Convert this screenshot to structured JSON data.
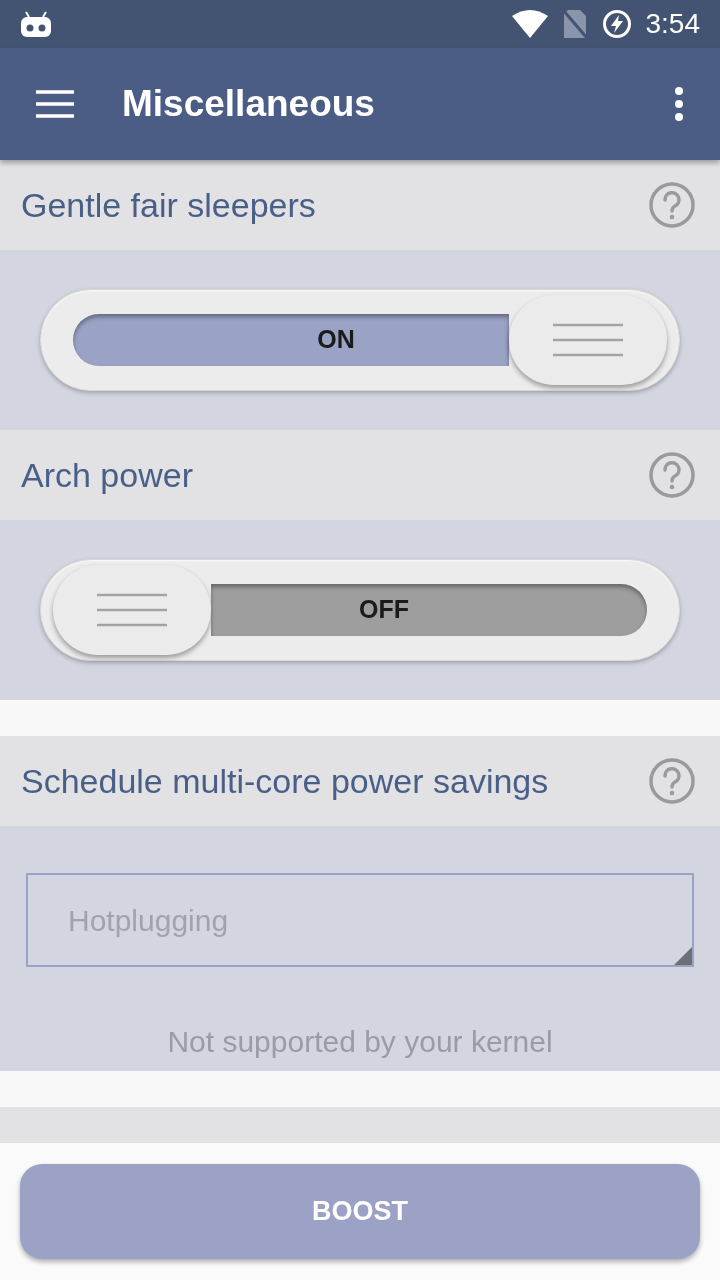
{
  "status_bar": {
    "time": "3:54"
  },
  "app_bar": {
    "title": "Miscellaneous"
  },
  "sections": [
    {
      "kind": "toggle",
      "title": "Gentle fair sleepers",
      "on": true,
      "label": "ON"
    },
    {
      "kind": "toggle",
      "title": "Arch power",
      "on": false,
      "label": "OFF"
    },
    {
      "kind": "select",
      "title": "Schedule multi-core power savings",
      "value": "Hotplugging",
      "disabled": true,
      "note": "Not supported by your kernel"
    },
    {
      "kind": "hidden"
    }
  ],
  "boost_button": {
    "label": "BOOST"
  }
}
